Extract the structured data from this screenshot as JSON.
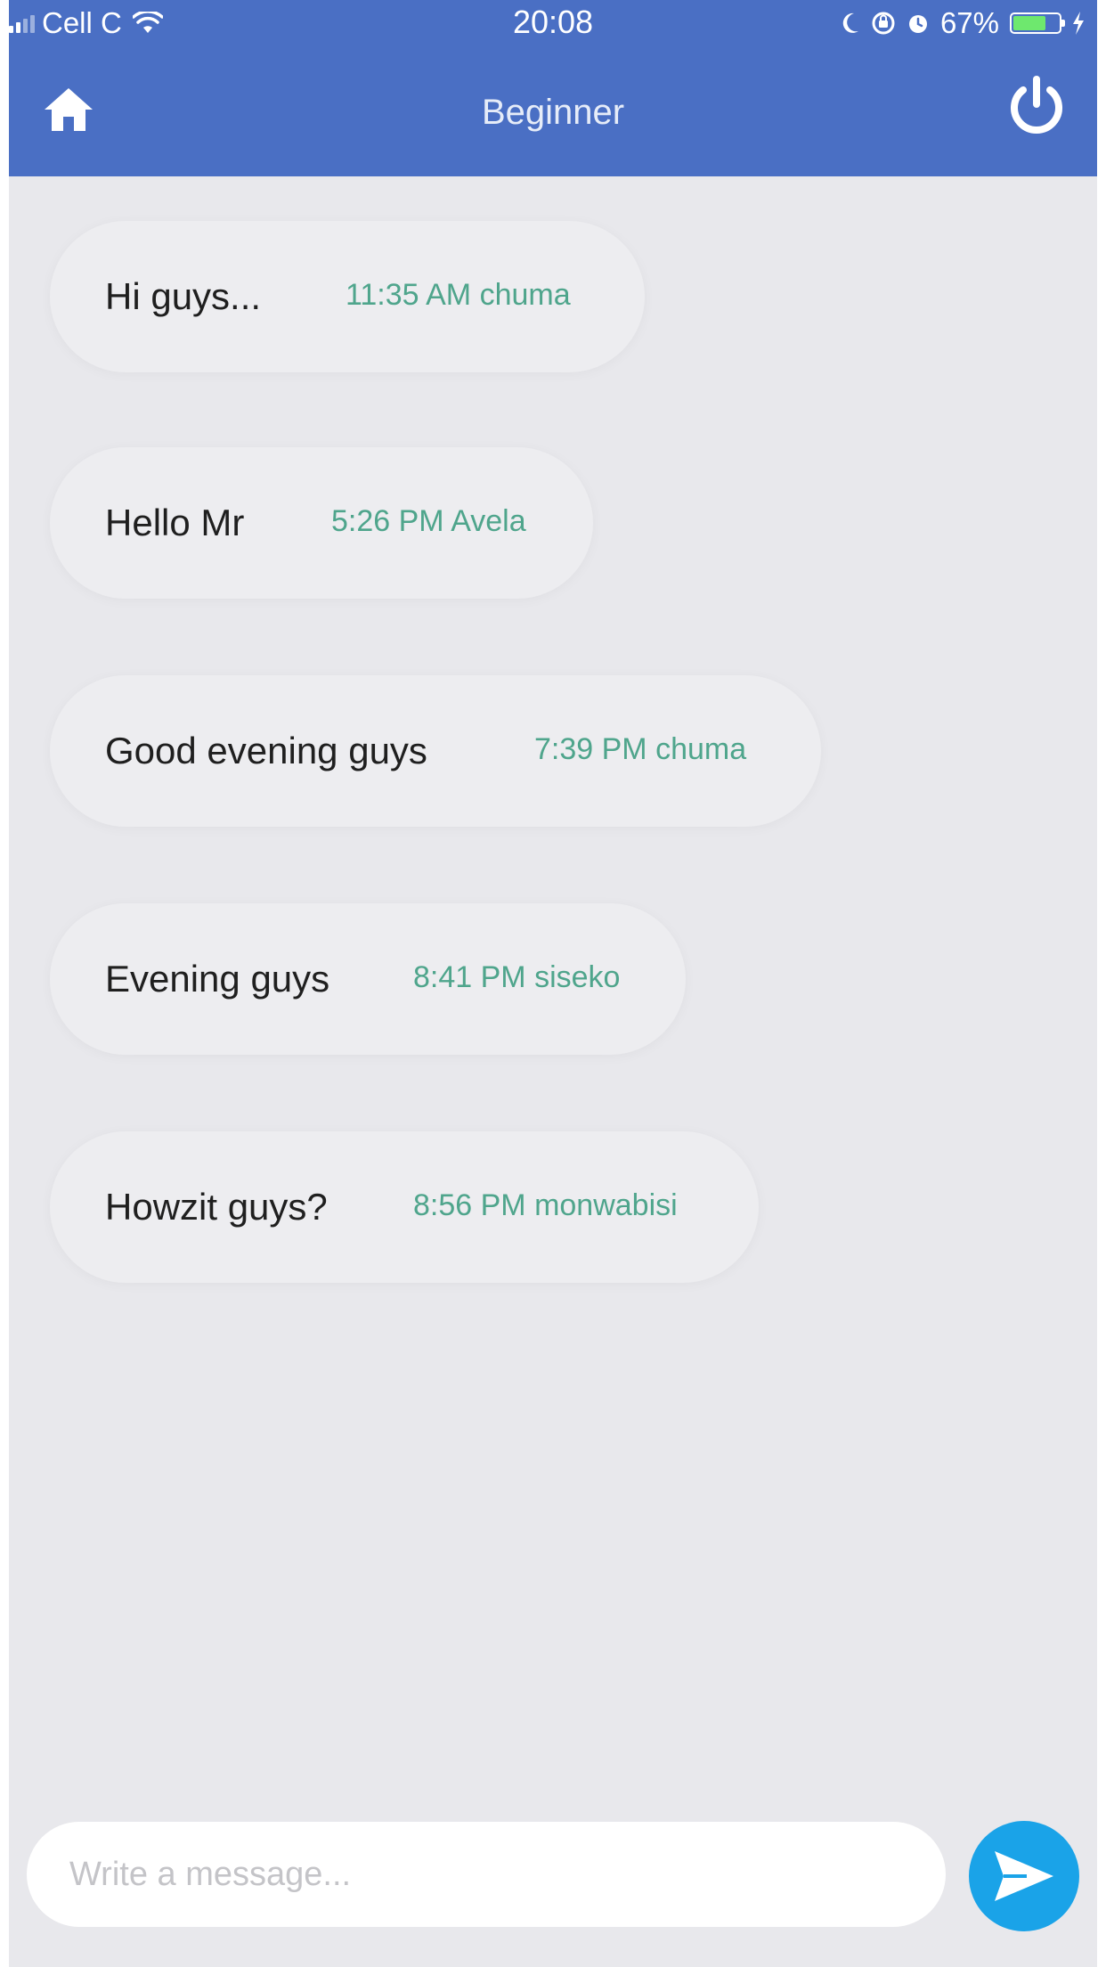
{
  "status_bar": {
    "carrier": "Cell C",
    "time": "20:08",
    "battery_percent": "67%",
    "battery_level": 0.67,
    "icons": [
      "signal-icon",
      "wifi-icon",
      "moon-icon",
      "orientation-lock-icon",
      "alarm-icon",
      "battery-icon",
      "charging-icon"
    ]
  },
  "header": {
    "title": "Beginner",
    "home_icon": "home-icon",
    "power_icon": "power-icon"
  },
  "messages": [
    {
      "text": "Hi guys...",
      "time": "11:35 AM",
      "sender": "chuma"
    },
    {
      "text": "Hello Mr",
      "time": "5:26 PM",
      "sender": "Avela"
    },
    {
      "text": "Good  evening guys",
      "time": "7:39 PM",
      "sender": "chuma"
    },
    {
      "text": "Evening guys",
      "time": "8:41 PM",
      "sender": "siseko"
    },
    {
      "text": "Howzit guys?",
      "time": "8:56 PM",
      "sender": "monwabisi"
    }
  ],
  "composer": {
    "placeholder": "Write a message...",
    "value": "",
    "send_icon": "send-icon"
  },
  "colors": {
    "header": "#4a6fc4",
    "background": "#e8e8ec",
    "bubble": "#ededf0",
    "meta_text": "#4fa58c",
    "send_button": "#1aa3e8"
  }
}
